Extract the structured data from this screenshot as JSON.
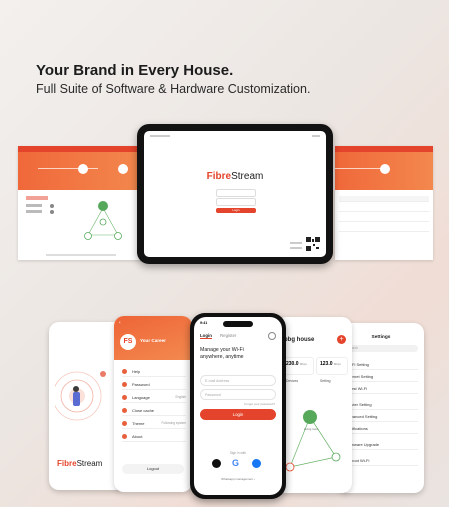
{
  "hero": {
    "title": "Your Brand in Every House.",
    "subtitle": "Full Suite of Software & Hardware Customization."
  },
  "tablet": {
    "brand_a": "Fibre",
    "brand_b": "Stream",
    "login_label": "Login"
  },
  "profile_phone": {
    "badge": "FS",
    "name": "Your Career",
    "items": [
      {
        "label": "Help"
      },
      {
        "label": "Password"
      },
      {
        "label": "Language",
        "value": "English"
      },
      {
        "label": "Close cache"
      },
      {
        "label": "Theme",
        "value": "Following system"
      },
      {
        "label": "About"
      }
    ],
    "logout": "Logout"
  },
  "splash_phone": {
    "brand_a": "Fibre",
    "brand_b": "Stream"
  },
  "login_phone": {
    "time": "9:41",
    "tab_login": "Login",
    "tab_register": "Register",
    "heading_line1": "Manage your Wi-Fi",
    "heading_line2": "anywhere, anytime",
    "email_placeholder": "E-mail Address",
    "password_placeholder": "Password",
    "forgot": "Forgot your password?",
    "login_button": "Login",
    "sign_in_with": "Sign in with",
    "whatsapp": "Whatsapp management ›"
  },
  "house_phone": {
    "title": "bbg house",
    "stat1_value": "230.0",
    "stat2_value": "123.0",
    "stat1_unit": "Mbps",
    "stat2_unit": "Mbps",
    "tab1": "Devices",
    "tab2": "Setting",
    "node_label": "Living room"
  },
  "settings_phone": {
    "title": "Settings",
    "search_placeholder": "Search",
    "items": [
      "Wi-Fi Setting",
      "Internet Setting",
      "Guest Wi-Fi",
      "Router Setting",
      "Advanced Setting",
      "Notifications",
      "Firmware Upgrade",
      "Reboot Wi-Fi"
    ]
  },
  "colors": {
    "brand_red": "#e4442b",
    "brand_orange": "#f0683a"
  }
}
